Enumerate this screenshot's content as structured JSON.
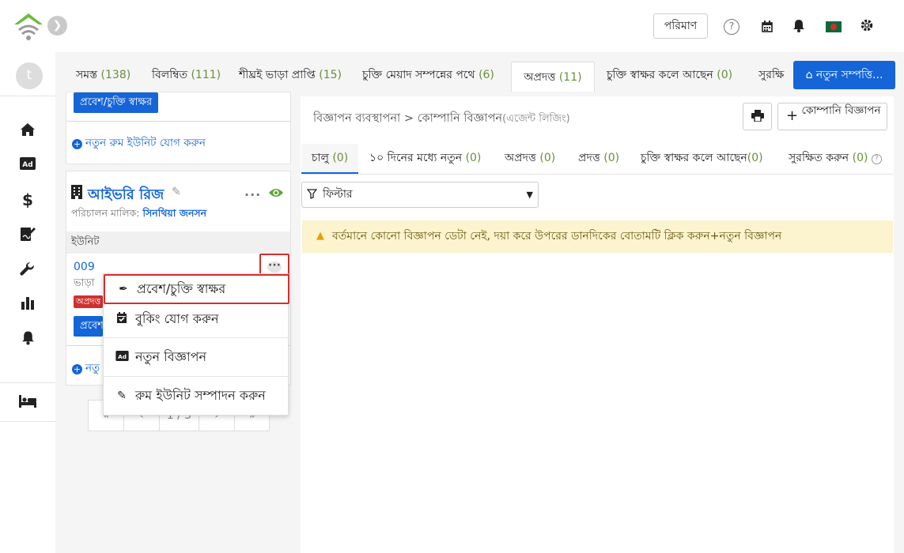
{
  "header": {
    "pariman_label": "পরিমাণ",
    "help_glyph": "?"
  },
  "user": {
    "initial": "t"
  },
  "tabs": [
    {
      "label": "সমস্ত",
      "count": "(138)"
    },
    {
      "label": "বিলম্বিত",
      "count": "(111)"
    },
    {
      "label": "শীঘ্রই ভাড়া প্রাপ্তি",
      "count": "(15)"
    },
    {
      "label": "চুক্তি মেয়াদ সম্পন্নের পথে",
      "count": "(6)"
    },
    {
      "label": "অপ্রদত্ত",
      "count": "(11)"
    },
    {
      "label": "চুক্তি স্বাক্ষর কলে আছেন",
      "count": "(0)"
    },
    {
      "label": "সুরক্ষি",
      "count": ""
    }
  ],
  "new_property_button": "নতুন সম্পত্তি...",
  "left": {
    "checkin_button": "প্রবেশ/চুক্তি স্বাক্ষর",
    "add_room_unit": "নতুন রুম ইউনিট যোগ করুন",
    "property_name": "আইভরি রিজ",
    "owner_label": "পরিচালন মালিক:",
    "owner_name": "সিনথিয়া জনসন",
    "units_heading": "ইউনিট",
    "unit_number": "009",
    "unit_rent_partial": "ভাড়া",
    "unit_badge_partial": "অপ্রদত্ত",
    "unit_btn_partial": "প্রবেশ",
    "add_link_partial": "নতু",
    "pager_page": "1 / 5"
  },
  "menu": {
    "items": [
      {
        "label": "প্রবেশ/চুক্তি স্বাক্ষর",
        "icon": "pen-icon"
      },
      {
        "label": "বুকিং যোগ করুন",
        "icon": "calendar-check-icon"
      },
      {
        "label": "নতুন বিজ্ঞাপন",
        "icon": "ad-icon"
      },
      {
        "label": "রুম ইউনিট সম্পাদন করুন",
        "icon": "edit-icon"
      }
    ]
  },
  "right": {
    "breadcrumb_main": "বিজ্ঞাপন ব্যবস্থাপনা",
    "breadcrumb_sep": ">",
    "breadcrumb_current": "কোম্পানি বিজ্ঞাপন",
    "breadcrumb_sub": "(এজেন্ট লিজিং)",
    "company_ad_button": "কোম্পানি বিজ্ঞাপন",
    "subtabs": [
      {
        "label": "চালু",
        "count": "(0)"
      },
      {
        "label": "১০ দিনের মধ্যে নতুন",
        "count": "(0)"
      },
      {
        "label": "অপ্রদত্ত",
        "count": "(0)"
      },
      {
        "label": "প্রদত্ত",
        "count": "(0)"
      },
      {
        "label": "চুক্তি স্বাক্ষর কলে আছেন",
        "count": "(0)"
      },
      {
        "label": "সুরক্ষিত করুন",
        "count": "(0)"
      }
    ],
    "filter_label": "ফিল্টার",
    "alert_text": "বর্তমানে কোনো বিজ্ঞাপন ডেটা নেই, দয়া করে উপরের ডানদিকের বোতামটি ক্লিক করুন+নতুন বিজ্ঞাপন"
  },
  "colors": {
    "accent": "#1565d8",
    "count_green": "#6a8f3a",
    "highlight_red": "#d32f2f",
    "alert_bg": "#fcf3cf"
  }
}
